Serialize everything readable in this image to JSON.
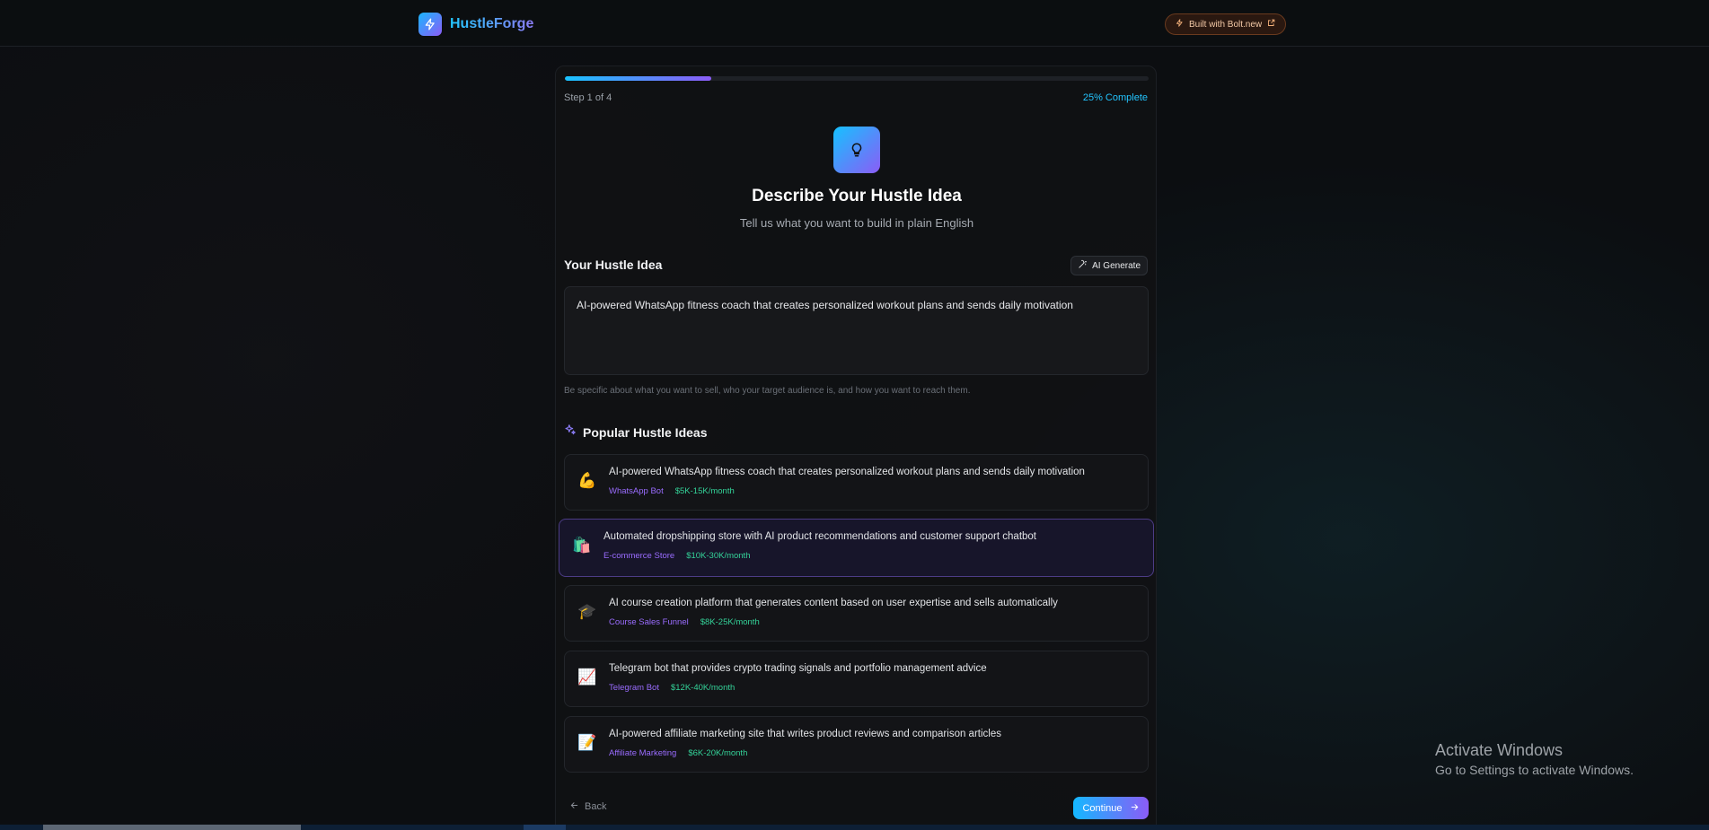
{
  "header": {
    "brand_name": "HustleForge",
    "brand_icon": "bolt-icon",
    "badge_label": "Built with Bolt.new",
    "badge_icon": "lightning-icon",
    "badge_external_icon": "external-link-icon"
  },
  "progress": {
    "step_text": "Step 1 of 4",
    "percent_text": "25% Complete",
    "fraction": 0.25
  },
  "hero": {
    "icon": "lightbulb-icon",
    "title": "Describe Your Hustle Idea",
    "subtitle": "Tell us what you want to build in plain English"
  },
  "idea_input": {
    "label": "Your Hustle Idea",
    "ai_generate_label": "AI Generate",
    "ai_generate_icon": "magic-wand-icon",
    "value": "AI-powered WhatsApp fitness coach that creates personalized workout plans and sends daily motivation",
    "hint": "Be specific about what you want to sell, who your target audience is, and how you want to reach them."
  },
  "popular": {
    "heading": "Popular Hustle Ideas",
    "heading_icon": "sparkles-icon",
    "items": [
      {
        "emoji": "💪",
        "description": "AI-powered WhatsApp fitness coach that creates personalized workout plans and sends daily motivation",
        "category": "WhatsApp Bot",
        "revenue": "$5K-15K/month",
        "selected": false
      },
      {
        "emoji": "🛍️",
        "description": "Automated dropshipping store with AI product recommendations and customer support chatbot",
        "category": "E-commerce Store",
        "revenue": "$10K-30K/month",
        "selected": true
      },
      {
        "emoji": "🎓",
        "description": "AI course creation platform that generates content based on user expertise and sells automatically",
        "category": "Course Sales Funnel",
        "revenue": "$8K-25K/month",
        "selected": false
      },
      {
        "emoji": "📈",
        "description": "Telegram bot that provides crypto trading signals and portfolio management advice",
        "category": "Telegram Bot",
        "revenue": "$12K-40K/month",
        "selected": false
      },
      {
        "emoji": "📝",
        "description": "AI-powered affiliate marketing site that writes product reviews and comparison articles",
        "category": "Affiliate Marketing",
        "revenue": "$6K-20K/month",
        "selected": false
      }
    ]
  },
  "nav": {
    "back_label": "Back",
    "back_icon": "arrow-left-icon",
    "continue_label": "Continue",
    "continue_icon": "arrow-right-icon"
  },
  "os_watermark": {
    "line1": "Activate Windows",
    "line2": "Go to Settings to activate Windows."
  },
  "colors": {
    "accent_cyan": "#19c3ff",
    "accent_purple": "#8b5cf6",
    "category_purple": "#9a6cff",
    "revenue_green": "#34d399",
    "background": "#0c0e11"
  }
}
